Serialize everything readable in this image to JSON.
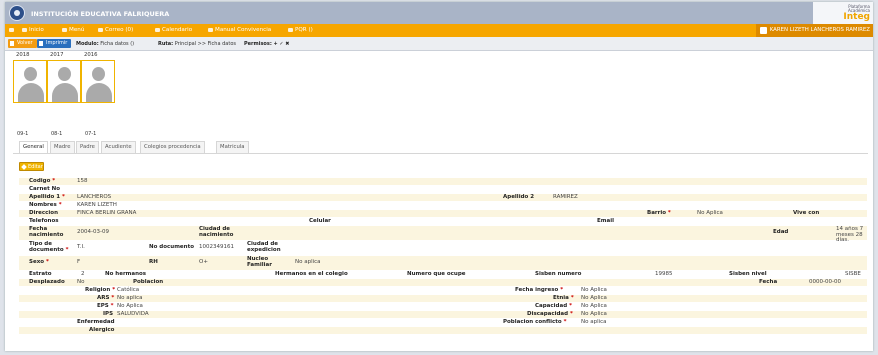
{
  "header": {
    "school_name": "INSTITUCIÓN EDUCATIVA FALRIQUERA",
    "brand_line1": "Plataforma",
    "brand_line2": "Académica",
    "brand_name": "Integ"
  },
  "menu": {
    "items": [
      "Inicio",
      "Menú",
      "Correo (0)",
      "Calendario",
      "Manual Convivencia",
      "PQR ()"
    ],
    "user_label": "KAREN LIZETH LANCHEROS RAMIREZ"
  },
  "toolbar": {
    "back_label": "Volver",
    "print_label": "Imprimir",
    "module_label": "Modulo:",
    "module_value": "Ficha datos ()",
    "route_label": "Ruta:",
    "route_value": "Principal >> Ficha datos",
    "permissions_label": "Permisos:",
    "permissions_icons": "+ ✓ ✖"
  },
  "photos": [
    {
      "year": "2018",
      "group": "09-1"
    },
    {
      "year": "2017",
      "group": "08-1"
    },
    {
      "year": "2016",
      "group": "07-1"
    }
  ],
  "tabs": [
    "General",
    "Madre",
    "Padre",
    "Acudiente",
    "Colegios procedencia",
    "Matricula"
  ],
  "edit_label": "Editar",
  "colors": {
    "menu_orange": "#f6a600",
    "print_blue": "#2a6fbe",
    "top_gray": "#a9b4c7",
    "required_red": "#cc0000"
  },
  "form": {
    "codigo_label": "Codigo",
    "codigo_value": "158",
    "carnet_label": "Carnet No",
    "apellido1_label": "Apellido 1",
    "apellido1_value": "LANCHEROS",
    "apellido2_label": "Apellido 2",
    "apellido2_value": "RAMIREZ",
    "nombres_label": "Nombres",
    "nombres_value": "KAREN LIZETH",
    "direccion_label": "Direccion",
    "direccion_value": "FINCA BERLIN GRANA",
    "barrio_label": "Barrio",
    "barrio_value": "No Aplica",
    "vive_label": "Vive con",
    "telefonos_label": "Telefonos",
    "celular_label": "Celular",
    "email_label": "Email",
    "fecha_nac_label": "Fecha nacimiento",
    "fecha_nac_value": "2004-03-09",
    "ciudad_nac_label": "Ciudad de nacimiento",
    "edad_label": "Edad",
    "edad_value": "14 años 7 meses 28 días.",
    "tipo_doc_label": "Tipo de documento",
    "tipo_doc_value": "T.I.",
    "no_doc_label": "No documento",
    "no_doc_value": "1002349161",
    "ciudad_exp_label": "Ciudad de expedicion",
    "sexo_label": "Sexo",
    "sexo_value": "F",
    "rh_label": "RH",
    "rh_value": "O+",
    "nucleo_label": "Nucleo Familiar",
    "nucleo_value": "No aplica",
    "estrato_label": "Estrato",
    "estrato_value": "2",
    "no_hermanos_label": "No hermanos",
    "hermanos_col_label": "Hermanos en el colegio",
    "numero_ocupa_label": "Numero que ocupe",
    "sisben_num_label": "Sisben numero",
    "sisben_num_value": "19985",
    "sisben_nivel_label": "Sisben nivel",
    "sisben_nivel_value": "SISBE",
    "desplazado_label": "Desplazado",
    "desplazado_value": "No",
    "poblacion_label": "Poblacion",
    "fecha_label": "Fecha",
    "fecha_value": "0000-00-00",
    "religion_label": "Religion",
    "religion_value": "Católica",
    "fecha_ingreso_label": "Fecha ingreso",
    "fecha_ingreso_value": "No Aplica",
    "ars_label": "ARS",
    "ars_value": "No aplica",
    "etnia_label": "Etnia",
    "etnia_value": "No Aplica",
    "eps_label": "EPS",
    "eps_value": "No Aplica",
    "capacidad_label": "Capacidad",
    "capacidad_value": "No Aplica",
    "ips_label": "IPS",
    "ips_value": "SALUDVIDA",
    "discapacidad_label": "Discapacidad",
    "discapacidad_value": "No Aplica",
    "enfermedad_label": "Enfermedad",
    "pob_conflicto_label": "Poblacion conflicto",
    "pob_conflicto_value": "No aplica",
    "alergico_label": "Alergico"
  }
}
